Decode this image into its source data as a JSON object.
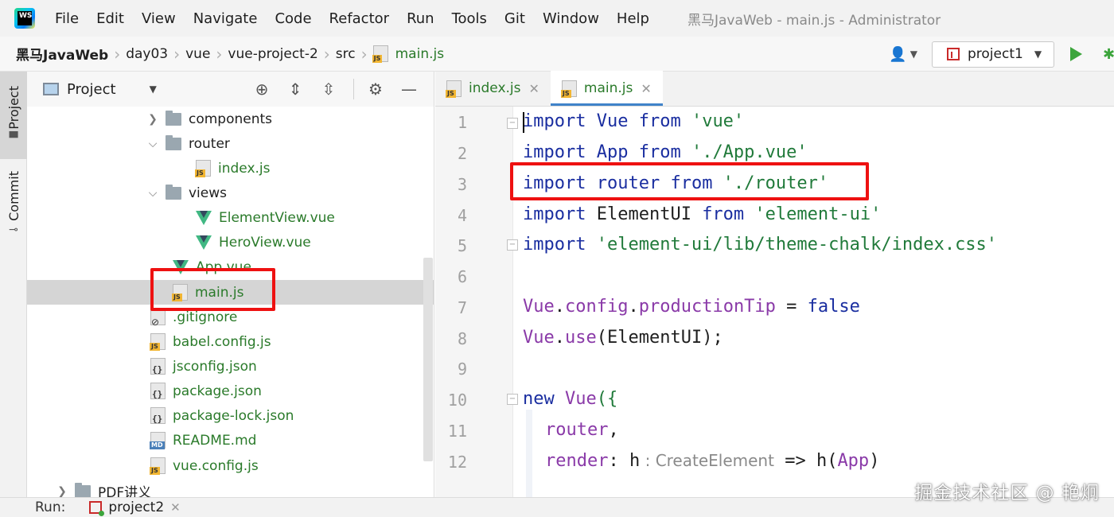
{
  "menubar": {
    "logo_text": "WS",
    "items": [
      "File",
      "Edit",
      "View",
      "Navigate",
      "Code",
      "Refactor",
      "Run",
      "Tools",
      "Git",
      "Window",
      "Help"
    ],
    "window_title": "黑马JavaWeb - main.js - Administrator"
  },
  "breadcrumb": {
    "items": [
      "黑马JavaWeb",
      "day03",
      "vue",
      "vue-project-2",
      "src",
      "main.js"
    ]
  },
  "toolbar": {
    "run_config": "project1",
    "user_icon": "user-icon",
    "run_icon": "run-icon",
    "debug_icon": "debug-icon"
  },
  "toolstrip": {
    "project_tab": "Project",
    "commit_tab": "Commit"
  },
  "project_panel": {
    "title": "Project",
    "tree": [
      {
        "label": "components",
        "type": "folder",
        "expanded": false
      },
      {
        "label": "router",
        "type": "folder",
        "expanded": true
      },
      {
        "label": "index.js",
        "type": "js"
      },
      {
        "label": "views",
        "type": "folder",
        "expanded": true
      },
      {
        "label": "ElementView.vue",
        "type": "vue"
      },
      {
        "label": "HeroView.vue",
        "type": "vue"
      },
      {
        "label": "App.vue",
        "type": "vue"
      },
      {
        "label": "main.js",
        "type": "js",
        "selected": true
      },
      {
        "label": ".gitignore",
        "type": "ignore"
      },
      {
        "label": "babel.config.js",
        "type": "js"
      },
      {
        "label": "jsconfig.json",
        "type": "json"
      },
      {
        "label": "package.json",
        "type": "json"
      },
      {
        "label": "package-lock.json",
        "type": "json"
      },
      {
        "label": "README.md",
        "type": "md"
      },
      {
        "label": "vue.config.js",
        "type": "js"
      },
      {
        "label": "PDF讲义",
        "type": "folder",
        "expanded": false
      }
    ]
  },
  "editor": {
    "tabs": [
      {
        "label": "index.js",
        "active": false
      },
      {
        "label": "main.js",
        "active": true
      }
    ],
    "line_numbers": [
      "1",
      "2",
      "3",
      "4",
      "5",
      "6",
      "7",
      "8",
      "9",
      "10",
      "11",
      "12"
    ],
    "code": {
      "l1": [
        "import",
        " Vue ",
        "from",
        " 'vue'"
      ],
      "l2": [
        "import",
        " App ",
        "from",
        " './App.vue'"
      ],
      "l3": [
        "import",
        " router ",
        "from",
        " './router'"
      ],
      "l4": [
        "import",
        " ElementUI ",
        "from",
        " 'element-ui'"
      ],
      "l5": [
        "import",
        " 'element-ui/lib/theme-chalk/index.css'"
      ],
      "l7": [
        "Vue",
        ".",
        "config",
        ".",
        "productionTip",
        " = ",
        "false"
      ],
      "l8": [
        "Vue",
        ".",
        "use",
        "(ElementUI);"
      ],
      "l10": [
        "new",
        " Vue",
        "({"
      ],
      "l11": [
        "router",
        ","
      ],
      "l12": [
        "render",
        ": ",
        "h",
        " : CreateElement",
        " => ",
        "h",
        "(",
        "App",
        ")"
      ]
    }
  },
  "runbar": {
    "label": "Run:",
    "tab": "project2"
  },
  "watermark": "掘金技术社区 @ 艳炯",
  "colors": {
    "annotation_red": "#ee1111",
    "keyword": "#1a2ea0",
    "string": "#207a3a",
    "property": "#8a3aa8",
    "file_green": "#2a7a2a",
    "active_tab_underline": "#4083c9"
  }
}
